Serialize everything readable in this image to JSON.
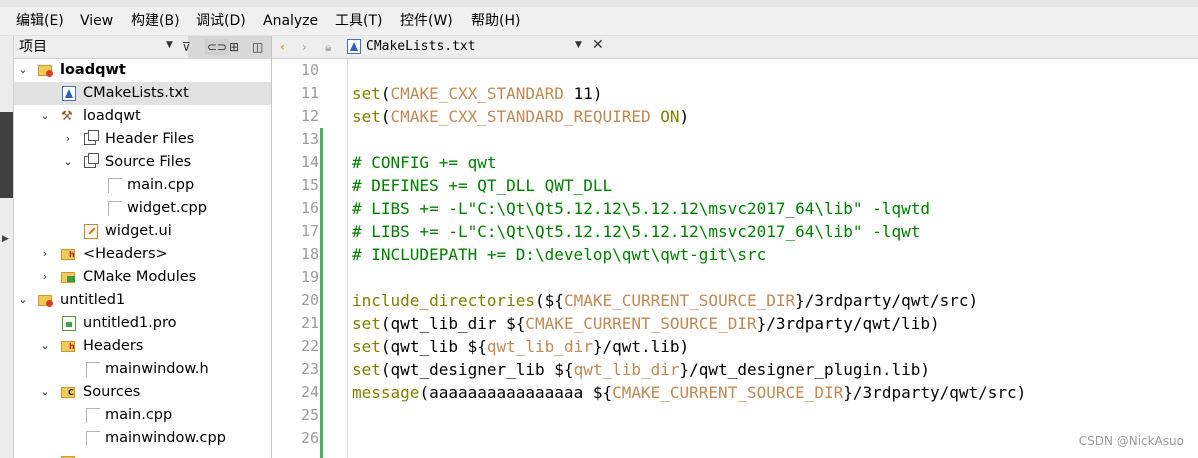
{
  "menubar": {
    "items": [
      "编辑(E)",
      "View",
      "构建(B)",
      "调试(D)",
      "Analyze",
      "工具(T)",
      "控件(W)",
      "帮助(H)"
    ]
  },
  "project_panel": {
    "title": "项目",
    "tree": [
      {
        "label": "loadqwt",
        "level": 0,
        "expanded": true,
        "icon": "cmake-project-folder-icon",
        "bold": true
      },
      {
        "label": "CMakeLists.txt",
        "level": 1,
        "icon": "cmake-file-icon",
        "selected": true
      },
      {
        "label": "loadqwt",
        "level": 1,
        "expanded": true,
        "icon": "hammer-icon"
      },
      {
        "label": "Header Files",
        "level": 2,
        "expanded": false,
        "icon": "virtual-folder-icon"
      },
      {
        "label": "Source Files",
        "level": 2,
        "expanded": true,
        "icon": "virtual-folder-icon"
      },
      {
        "label": "main.cpp",
        "level": 3,
        "icon": "file-icon"
      },
      {
        "label": "widget.cpp",
        "level": 3,
        "icon": "file-icon"
      },
      {
        "label": "widget.ui",
        "level": 2,
        "icon": "ui-file-icon"
      },
      {
        "label": "<Headers>",
        "level": 1,
        "expanded": false,
        "icon": "headers-folder-icon"
      },
      {
        "label": "CMake Modules",
        "level": 1,
        "expanded": false,
        "icon": "cmake-modules-folder-icon"
      },
      {
        "label": "untitled1",
        "level": 0,
        "expanded": true,
        "icon": "qmake-project-folder-icon"
      },
      {
        "label": "untitled1.pro",
        "level": 1,
        "icon": "pro-file-icon"
      },
      {
        "label": "Headers",
        "level": 1,
        "expanded": true,
        "icon": "headers-folder-icon"
      },
      {
        "label": "mainwindow.h",
        "level": 2,
        "icon": "file-icon"
      },
      {
        "label": "Sources",
        "level": 1,
        "expanded": true,
        "icon": "sources-folder-icon"
      },
      {
        "label": "main.cpp",
        "level": 2,
        "icon": "file-icon"
      },
      {
        "label": "mainwindow.cpp",
        "level": 2,
        "icon": "file-icon"
      }
    ]
  },
  "editor": {
    "file_name": "CMakeLists.txt",
    "lines": [
      {
        "num": "10",
        "tokens": []
      },
      {
        "num": "11",
        "tokens": [
          {
            "t": "set",
            "c": "kw"
          },
          {
            "t": "(",
            "c": "txt"
          },
          {
            "t": "CMAKE_CXX_STANDARD",
            "c": "var"
          },
          {
            "t": " 11)",
            "c": "txt"
          }
        ]
      },
      {
        "num": "12",
        "tokens": [
          {
            "t": "set",
            "c": "kw"
          },
          {
            "t": "(",
            "c": "txt"
          },
          {
            "t": "CMAKE_CXX_STANDARD_REQUIRED",
            "c": "var"
          },
          {
            "t": " ",
            "c": "txt"
          },
          {
            "t": "ON",
            "c": "kw"
          },
          {
            "t": ")",
            "c": "txt"
          }
        ]
      },
      {
        "num": "13",
        "tokens": []
      },
      {
        "num": "14",
        "tokens": [
          {
            "t": "# CONFIG += qwt",
            "c": "cmt"
          }
        ]
      },
      {
        "num": "15",
        "tokens": [
          {
            "t": "# DEFINES += QT_DLL QWT_DLL",
            "c": "cmt"
          }
        ]
      },
      {
        "num": "16",
        "tokens": [
          {
            "t": "# LIBS += -L\"C:\\Qt\\Qt5.12.12\\5.12.12\\msvc2017_64\\lib\" -lqwtd",
            "c": "cmt"
          }
        ]
      },
      {
        "num": "17",
        "tokens": [
          {
            "t": "# LIBS += -L\"C:\\Qt\\Qt5.12.12\\5.12.12\\msvc2017_64\\lib\" -lqwt",
            "c": "cmt"
          }
        ]
      },
      {
        "num": "18",
        "tokens": [
          {
            "t": "# INCLUDEPATH += D:\\develop\\qwt\\qwt-git\\src",
            "c": "cmt"
          }
        ]
      },
      {
        "num": "19",
        "tokens": []
      },
      {
        "num": "20",
        "tokens": [
          {
            "t": "include_directories",
            "c": "kw"
          },
          {
            "t": "(",
            "c": "txt"
          },
          {
            "t": "${",
            "c": "txt"
          },
          {
            "t": "CMAKE_CURRENT_SOURCE_DIR",
            "c": "var"
          },
          {
            "t": "}/3rdparty/qwt/src)",
            "c": "txt"
          }
        ]
      },
      {
        "num": "21",
        "tokens": [
          {
            "t": "set",
            "c": "kw"
          },
          {
            "t": "(qwt_lib_dir ",
            "c": "txt"
          },
          {
            "t": "${",
            "c": "txt"
          },
          {
            "t": "CMAKE_CURRENT_SOURCE_DIR",
            "c": "var"
          },
          {
            "t": "}/3rdparty/qwt/lib)",
            "c": "txt"
          }
        ]
      },
      {
        "num": "22",
        "tokens": [
          {
            "t": "set",
            "c": "kw"
          },
          {
            "t": "(qwt_lib ",
            "c": "txt"
          },
          {
            "t": "${",
            "c": "txt"
          },
          {
            "t": "qwt_lib_dir",
            "c": "var"
          },
          {
            "t": "}/qwt.lib)",
            "c": "txt"
          }
        ]
      },
      {
        "num": "23",
        "tokens": [
          {
            "t": "set",
            "c": "kw"
          },
          {
            "t": "(qwt_designer_lib ",
            "c": "txt"
          },
          {
            "t": "${",
            "c": "txt"
          },
          {
            "t": "qwt_lib_dir",
            "c": "var"
          },
          {
            "t": "}/qwt_designer_plugin.lib)",
            "c": "txt"
          }
        ]
      },
      {
        "num": "24",
        "tokens": [
          {
            "t": "message",
            "c": "kw"
          },
          {
            "t": "(aaaaaaaaaaaaaaaa ",
            "c": "txt"
          },
          {
            "t": "${",
            "c": "txt"
          },
          {
            "t": "CMAKE_CURRENT_SOURCE_DIR",
            "c": "var"
          },
          {
            "t": "}/3rdparty/qwt/src)",
            "c": "txt"
          }
        ]
      },
      {
        "num": "25",
        "tokens": []
      },
      {
        "num": "26",
        "tokens": []
      }
    ]
  },
  "watermark": "CSDN @NickAsuo"
}
